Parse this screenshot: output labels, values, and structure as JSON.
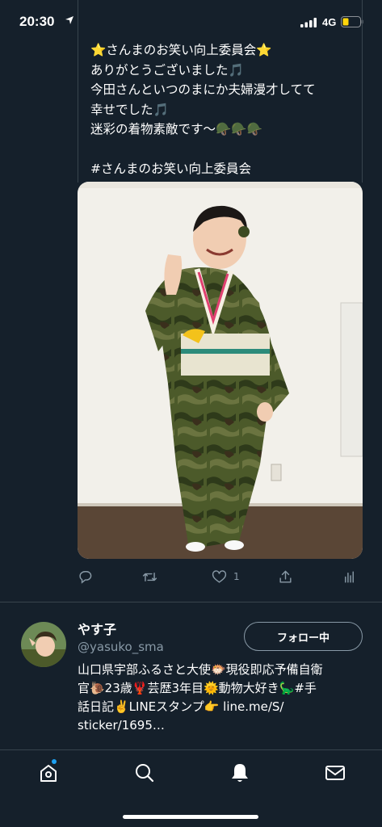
{
  "status_bar": {
    "time": "20:30",
    "network": "4G"
  },
  "tweet": {
    "lines": [
      "⭐さんまのお笑い向上委員会⭐",
      "ありがとうございました🎵",
      "今田さんといつのまにか夫婦漫才してて",
      "幸せでした🎵",
      "迷彩の着物素敵です〜🪖🪖🪖",
      "",
      "#さんまのお笑い向上委員会"
    ],
    "actions": {
      "reply_icon": "reply-icon",
      "retweet_icon": "retweet-icon",
      "like_icon": "heart-icon",
      "like_count": "1",
      "share_icon": "share-icon",
      "analytics_icon": "analytics-icon"
    }
  },
  "user_card": {
    "name": "やす子",
    "handle": "@yasuko_sma",
    "follow_label": "フォロー中",
    "bio_lines": [
      "山口県宇部ふるさと大使🐡現役即応予備自衛",
      "官🐌23歳🦞芸歴3年目🌞動物大好き🦕#手",
      "話日記✌️LINEスタンプ👉 line.me/S/",
      "sticker/1695…"
    ]
  },
  "tab_bar": {
    "items": [
      "home-icon",
      "search-icon",
      "notifications-icon",
      "messages-icon"
    ]
  },
  "colors": {
    "background": "#15202b",
    "divider": "#38444d",
    "secondary_text": "#8899a6",
    "accent": "#1da1f2"
  }
}
